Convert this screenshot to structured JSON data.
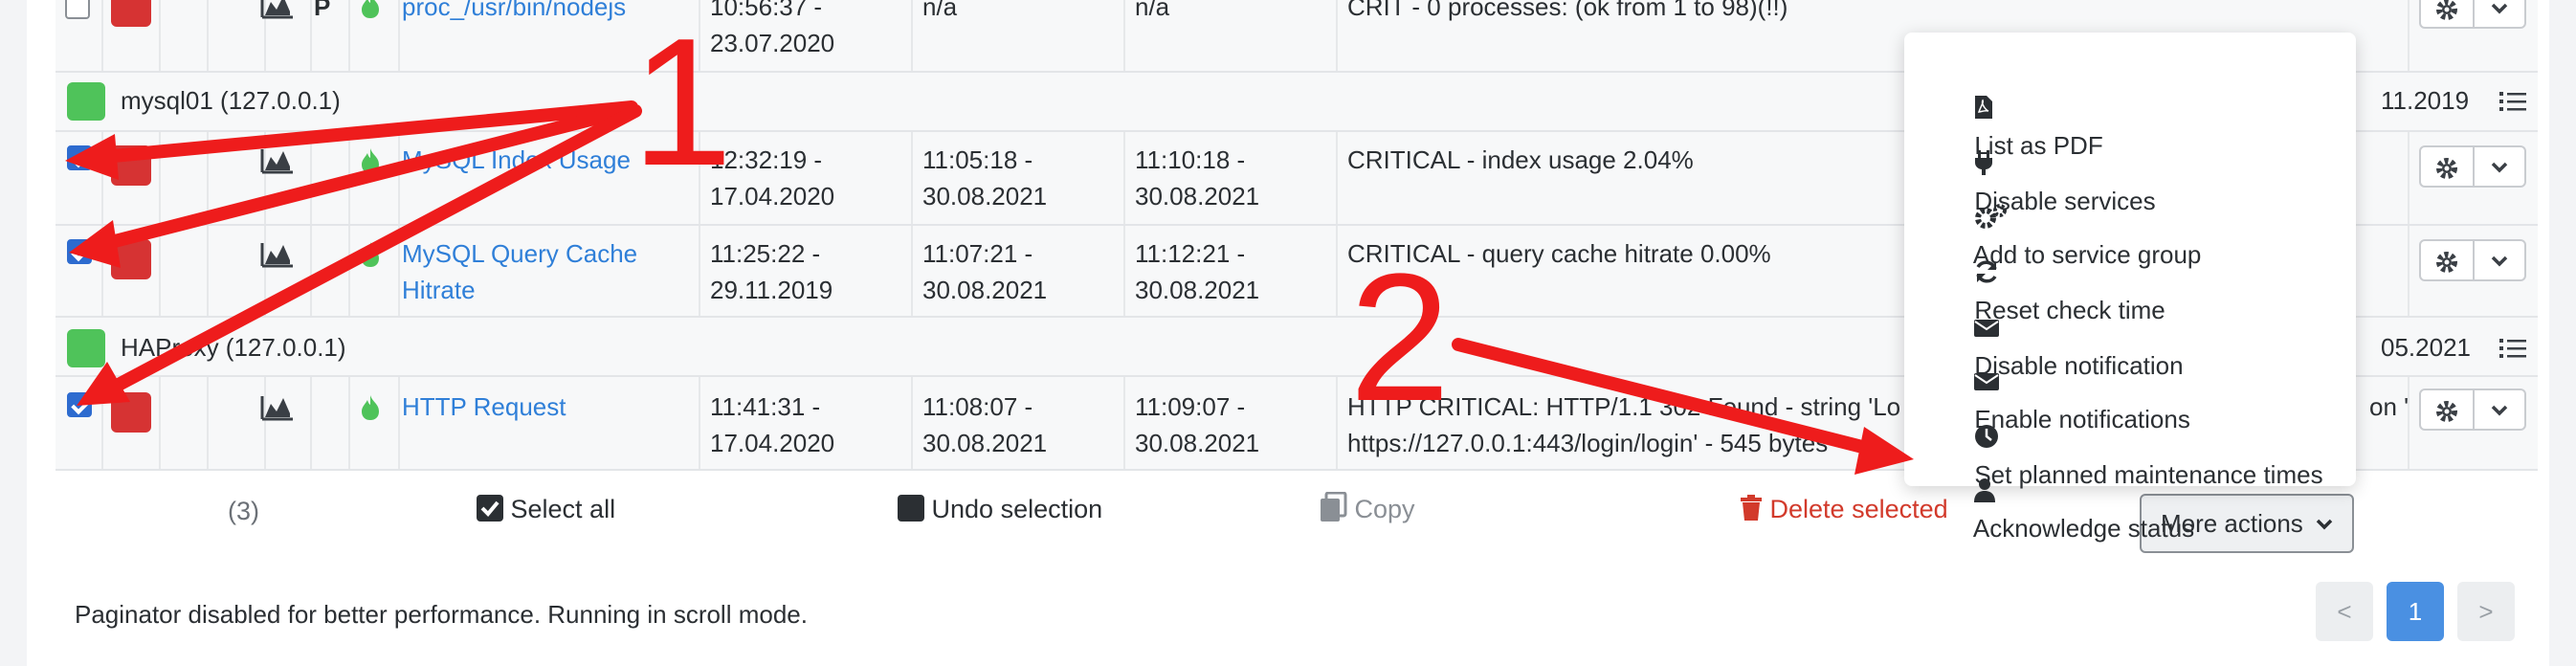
{
  "colors": {
    "accent": "#2d6bcf",
    "critical": "#d63333",
    "ok": "#4fc35a",
    "link": "#2f7fd8",
    "delete": "#d23a2b",
    "annotation": "#ee1c1c"
  },
  "rows": {
    "top": {
      "flag": "P",
      "service": "proc_/usr/bin/nodejs",
      "last_check_1": "10:56:37 -",
      "last_check_2": "23.07.2020",
      "last_change": "n/a",
      "next_check": "n/a",
      "output": "CRIT - 0 processes: (ok from 1 to 98)(!!)"
    },
    "host1": {
      "name": "mysql01 (127.0.0.1)",
      "date": "11.2019"
    },
    "svc1": {
      "service": "MySQL Index Usage",
      "c1a": "12:32:19 -",
      "c1b": "17.04.2020",
      "c2a": "11:05:18 -",
      "c2b": "30.08.2021",
      "c3a": "11:10:18 -",
      "c3b": "30.08.2021",
      "output": "CRITICAL - index usage 2.04%"
    },
    "svc2": {
      "service_a": "MySQL Query Cache",
      "service_b": "Hitrate",
      "c1a": "11:25:22 -",
      "c1b": "29.11.2019",
      "c2a": "11:07:21 -",
      "c2b": "30.08.2021",
      "c3a": "11:12:21 -",
      "c3b": "30.08.2021",
      "output": "CRITICAL - query cache hitrate 0.00%"
    },
    "host2": {
      "name": "HAProxy (127.0.0.1)",
      "date": "05.2021"
    },
    "svc3": {
      "service": "HTTP Request",
      "c1a": "11:41:31 -",
      "c1b": "17.04.2020",
      "c2a": "11:08:07 -",
      "c2b": "30.08.2021",
      "c3a": "11:09:07 -",
      "c3b": "30.08.2021",
      "output_a": "HTTP CRITICAL: HTTP/1.1 302 Found - string 'Lo",
      "output_b": "https://127.0.0.1:443/login/login' - 545 bytes",
      "output_tail": "on '"
    }
  },
  "footer": {
    "count": "(3)",
    "select_all": "Select all",
    "undo": "Undo selection",
    "copy": "Copy",
    "delete": "Delete selected",
    "more_actions": "More actions"
  },
  "menu": [
    "List as PDF",
    "Disable services",
    "Add to service group",
    "Reset check time",
    "Disable notification",
    "Enable notifications",
    "Set planned maintenance times",
    "Acknowledge status"
  ],
  "paginator": {
    "note": "Paginator disabled for better performance. Running in scroll mode.",
    "prev": "<",
    "page": "1",
    "next": ">"
  },
  "annotations": {
    "one": "1",
    "two": "2"
  }
}
